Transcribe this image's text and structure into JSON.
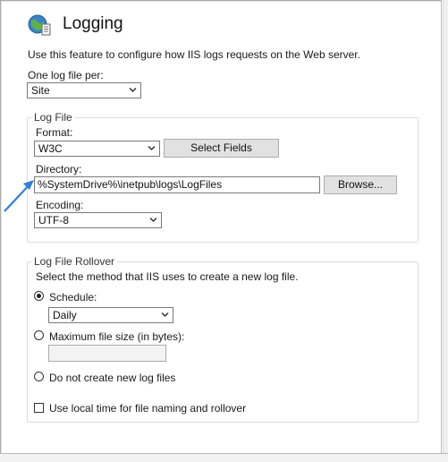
{
  "header": {
    "title": "Logging",
    "icon": "iis-logging-icon"
  },
  "description": "Use this feature to configure how IIS logs requests on the Web server.",
  "log_file_per": {
    "label": "One log file per:",
    "value": "Site"
  },
  "log_file": {
    "group_title": "Log File",
    "format_label": "Format:",
    "format_value": "W3C",
    "select_fields_label": "Select Fields",
    "directory_label": "Directory:",
    "directory_value": "%SystemDrive%\\inetpub\\logs\\LogFiles",
    "browse_label": "Browse...",
    "encoding_label": "Encoding:",
    "encoding_value": "UTF-8"
  },
  "rollover": {
    "group_title": "Log File Rollover",
    "instruction": "Select the method that IIS uses to create a new log file.",
    "schedule_label": "Schedule:",
    "schedule_value": "Daily",
    "max_size_label": "Maximum file size (in bytes):",
    "max_size_value": "",
    "no_new_label": "Do not create new log files",
    "selected": "schedule"
  },
  "local_time_label": "Use local time for file naming and rollover",
  "colors": {
    "accent_arrow": "#2f7fd8",
    "border": "#7a7a7a",
    "button_bg": "#e1e1e1"
  }
}
